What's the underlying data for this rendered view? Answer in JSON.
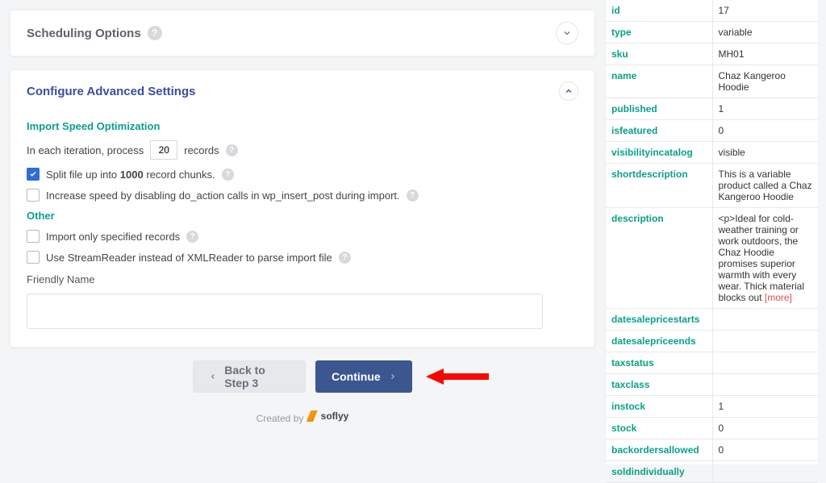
{
  "scheduling": {
    "title": "Scheduling Options"
  },
  "advanced": {
    "title": "Configure Advanced Settings",
    "speed_head": "Import Speed Optimization",
    "iter_pre": "In each iteration, process",
    "iter_value": "20",
    "iter_post": "records",
    "split_label": "Split file up into 1000 record chunks.",
    "disable_label": "Increase speed by disabling do_action calls in wp_insert_post during import.",
    "other_head": "Other",
    "only_specified": "Import only specified records",
    "stream_reader": "Use StreamReader instead of XMLReader to parse import file",
    "friendly_label": "Friendly Name"
  },
  "buttons": {
    "back": "Back to Step 3",
    "continue": "Continue"
  },
  "footer": {
    "created": "Created by",
    "brand": "soflyy"
  },
  "more_label": "[more]",
  "fields": [
    {
      "k": "id",
      "v": "17"
    },
    {
      "k": "type",
      "v": "variable"
    },
    {
      "k": "sku",
      "v": "MH01"
    },
    {
      "k": "name",
      "v": "Chaz Kangeroo Hoodie"
    },
    {
      "k": "published",
      "v": "1"
    },
    {
      "k": "isfeatured",
      "v": "0"
    },
    {
      "k": "visibilityincatalog",
      "v": "visible"
    },
    {
      "k": "shortdescription",
      "v": "This is a variable product called a Chaz Kangeroo Hoodie"
    },
    {
      "k": "description",
      "v": "<p>Ideal for cold-weather training or work outdoors, the Chaz Hoodie promises superior warmth with every wear. Thick material blocks out ",
      "more": true
    },
    {
      "k": "datesalepricestarts",
      "v": ""
    },
    {
      "k": "datesalepriceends",
      "v": ""
    },
    {
      "k": "taxstatus",
      "v": ""
    },
    {
      "k": "taxclass",
      "v": ""
    },
    {
      "k": "instock",
      "v": "1"
    },
    {
      "k": "stock",
      "v": "0"
    },
    {
      "k": "backordersallowed",
      "v": "0"
    },
    {
      "k": "soldindividually",
      "v": ""
    }
  ]
}
